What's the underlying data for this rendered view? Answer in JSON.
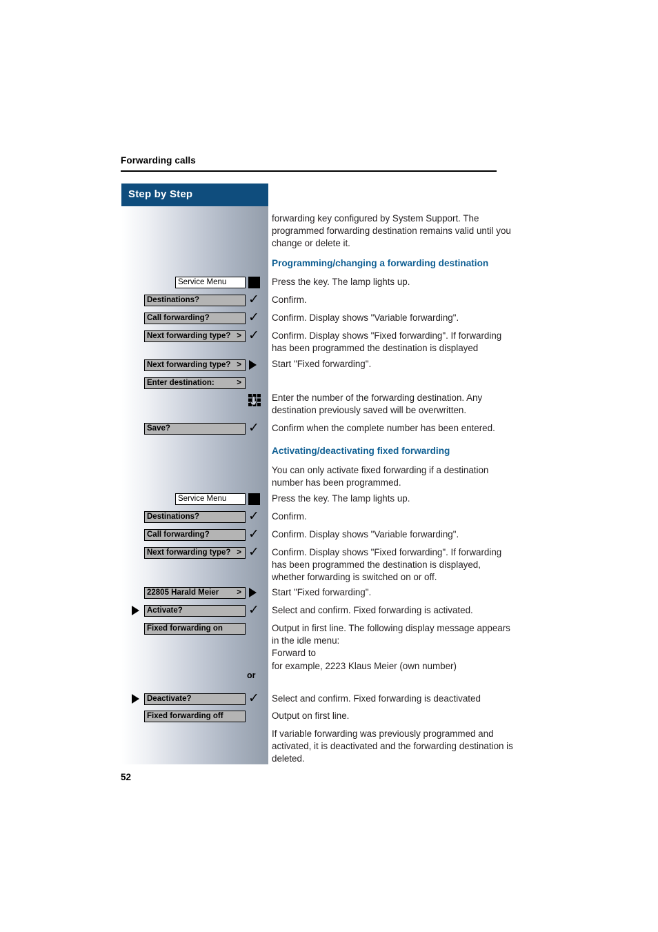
{
  "header": {
    "running_title": "Forwarding calls"
  },
  "sidebar": {
    "title": "Step by Step"
  },
  "folio": {
    "page_number": "52"
  },
  "labels": {
    "or": "or"
  },
  "colors": {
    "heading_blue": "#0f5f93",
    "sidebar_title_blue": "#0f4d7d",
    "pill_grey": "#b4b4b4",
    "body_text": "#231f20"
  },
  "intro": {
    "paragraph": "forwarding key configured by System Support. The programmed forwarding destination remains valid until you change or delete it."
  },
  "section1": {
    "heading": "Programming/changing a forwarding destination",
    "steps": [
      {
        "key_label": "Service Menu",
        "icon": "black-key-square",
        "text": "Press the key. The lamp lights up."
      },
      {
        "key_label": "Destinations?",
        "chevron": "",
        "icon": "checkmark-icon",
        "text": "Confirm."
      },
      {
        "key_label": "Call forwarding?",
        "chevron": "",
        "icon": "checkmark-icon",
        "text": "Confirm. Display shows \"Variable forwarding\"."
      },
      {
        "key_label": "Next forwarding type?",
        "chevron": ">",
        "icon": "checkmark-icon",
        "text": "Confirm. Display shows \"Fixed forwarding\". If forwarding has been programmed the destination is displayed"
      },
      {
        "key_label": "Next forwarding type?",
        "chevron": ">",
        "icon": "triangle-right-icon",
        "text": "Start \"Fixed forwarding\"."
      },
      {
        "key_label": "Enter destination:",
        "chevron": ">",
        "icon": "",
        "text": ""
      },
      {
        "key_label": "",
        "icon": "keypad-icon",
        "text": "Enter the number of the forwarding destination. Any destination previously saved will be overwritten."
      },
      {
        "key_label": "Save?",
        "chevron": "",
        "icon": "checkmark-icon",
        "text": "Confirm when the complete number has been entered."
      }
    ]
  },
  "section2": {
    "heading": "Activating/deactivating fixed forwarding",
    "intro": "You can only activate fixed forwarding if a destination number has been programmed.",
    "steps": [
      {
        "key_label": "Service Menu",
        "icon": "black-key-square",
        "text": "Press the key. The lamp lights up."
      },
      {
        "key_label": "Destinations?",
        "chevron": "",
        "icon": "checkmark-icon",
        "text": "Confirm."
      },
      {
        "key_label": "Call forwarding?",
        "chevron": "",
        "icon": "checkmark-icon",
        "text": "Confirm. Display shows \"Variable forwarding\"."
      },
      {
        "key_label": "Next forwarding type?",
        "chevron": ">",
        "icon": "checkmark-icon",
        "text": "Confirm. Display shows \"Fixed forwarding\". If forwarding has been programmed the destination is displayed, whether forwarding is switched on or off."
      },
      {
        "key_label": "22805 Harald Meier",
        "chevron": ">",
        "icon": "triangle-right-icon",
        "text": "Start \"Fixed forwarding\"."
      },
      {
        "key_label": "Activate?",
        "chevron": "",
        "icon": "checkmark-icon",
        "left_icon": "triangle-right-icon",
        "text": "Select and confirm. Fixed forwarding is activated."
      },
      {
        "key_label": "Fixed forwarding on",
        "chevron": "",
        "icon": "",
        "text": "Output in first line. The following display message appears in the idle menu:\nForward to\nfor example, 2223 Klaus Meier (own number)"
      },
      {
        "key_label": "Deactivate?",
        "chevron": "",
        "icon": "checkmark-icon",
        "left_icon": "triangle-right-icon",
        "text": "Select and confirm. Fixed forwarding is deactivated"
      },
      {
        "key_label": "Fixed forwarding off",
        "chevron": "",
        "icon": "",
        "text": "Output on first line."
      }
    ],
    "closing": "If variable forwarding was previously programmed and activated, it is deactivated and the forwarding destination is deleted."
  }
}
